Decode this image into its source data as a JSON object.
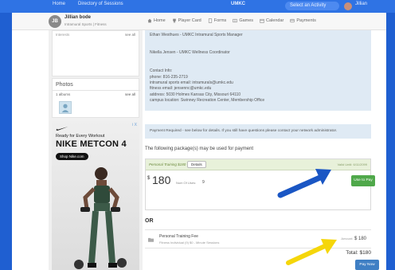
{
  "topbar": {
    "home": "Home",
    "directory": "Directory of Sessions",
    "brand": "UMKC",
    "account": "Select an Activity",
    "user": "Jillian"
  },
  "profile": {
    "initials": "JB",
    "name": "Jillian bode",
    "tagline": "Intramural Sports  |  Fitness"
  },
  "subnav": [
    {
      "label": "Home",
      "icon": "home-icon"
    },
    {
      "label": "Player Card",
      "icon": "trophy-icon"
    },
    {
      "label": "Forms",
      "icon": "document-icon"
    },
    {
      "label": "Games",
      "icon": "games-icon"
    },
    {
      "label": "Calendar",
      "icon": "calendar-icon"
    },
    {
      "label": "Payments",
      "icon": "card-icon"
    }
  ],
  "sidebar": {
    "card1_label": "Interests",
    "card1_see_all": "see all",
    "photos_title": "Photos",
    "photos_count": "1 albums",
    "photos_see_all": "see all"
  },
  "ad": {
    "choices": "i X",
    "tagline": "Ready for Every Workout",
    "headline": "NIKE METCON 4",
    "shop": "Shop Nike.com"
  },
  "info": {
    "lines": [
      "Ethan Westhues - UMKC Intramural Sports Manager",
      "Nikella Jensen - UMKC Wellness Coordinator",
      "Contact Info:",
      "phone: 816-235-2719",
      "intramural sports email: intramurals@umkc.edu",
      "fitness email: jensennc@umkc.edu",
      "address: 5030 Holmes Kansas City, Missouri 64110",
      "campus location: Swinney Recreation Center, Membership Office"
    ]
  },
  "notice": "Payment Required - see below for details. If you still have questions please contact your network administrator.",
  "following": "The following package(s) may be used for payment",
  "package1": {
    "name": "Personal Training $180",
    "details": "Details",
    "valid": "Valid Until: 6/11/2099",
    "currency": "$",
    "price": "180",
    "sessions_label": "Num Of Uses:",
    "sessions": "9",
    "use_button": "Use to Pay"
  },
  "or_label": "OR",
  "package2": {
    "name": "Personal Training Fee",
    "desc": "Fitness Individual (9) $0 - Minute Sessions",
    "amount_label": "Amount:",
    "amount": "$ 180"
  },
  "total": "Total: $180",
  "pay_button": "Pay Now",
  "colors": {
    "background": "#1f5fd1",
    "green": "#4fa84a",
    "pay": "#3f7fc4",
    "arrow_blue": "#1a56c4",
    "arrow_yellow": "#f5d60a"
  }
}
